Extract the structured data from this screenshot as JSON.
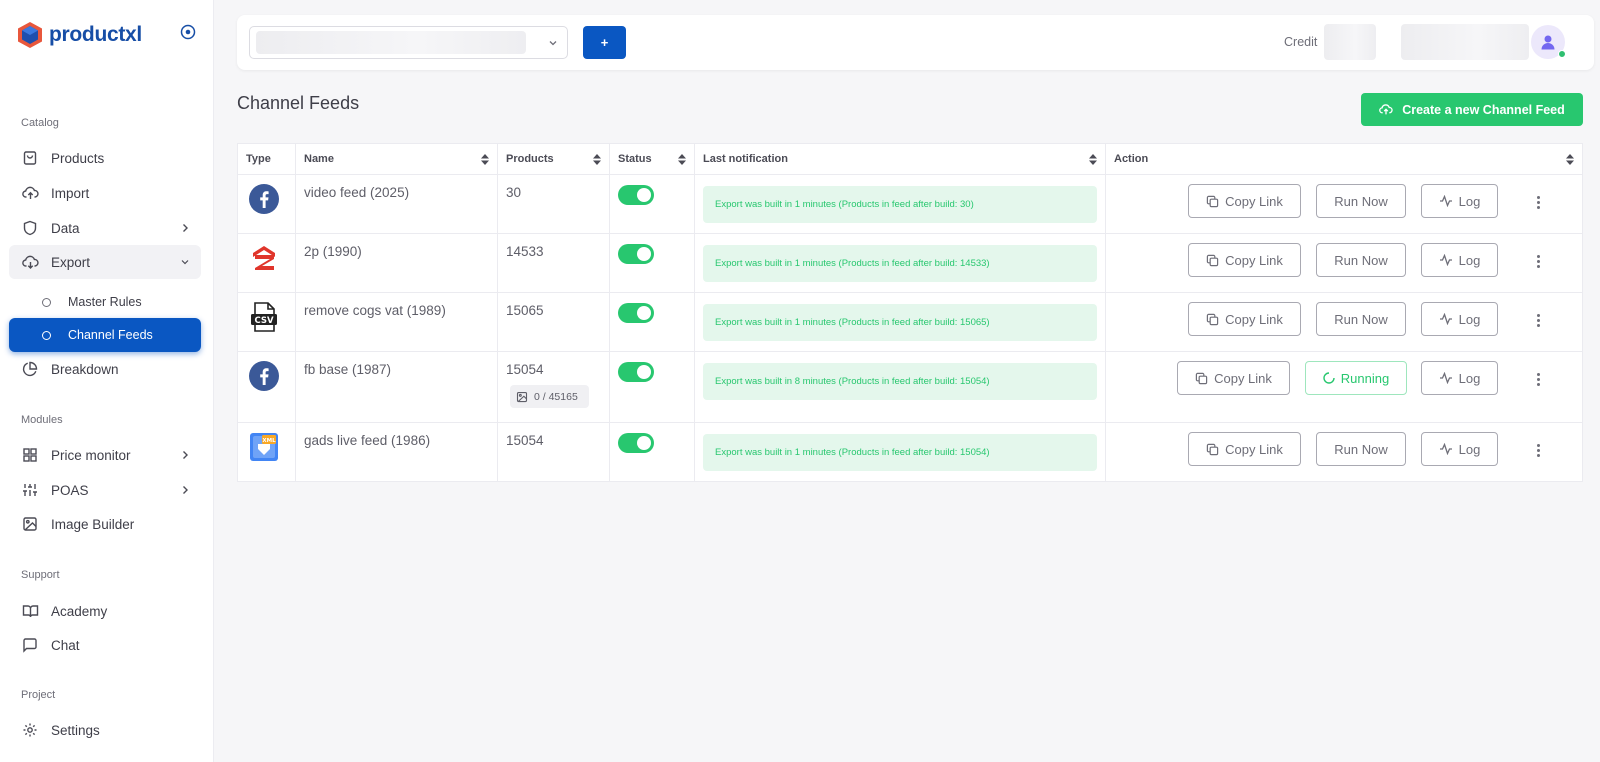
{
  "sidebar": {
    "logo_text": "productxl",
    "sections": {
      "catalog": "Catalog",
      "modules": "Modules",
      "support": "Support",
      "project": "Project"
    },
    "items": {
      "products": "Products",
      "import": "Import",
      "data": "Data",
      "export": "Export",
      "master_rules": "Master Rules",
      "channel_feeds": "Channel Feeds",
      "breakdown": "Breakdown",
      "price_monitor": "Price monitor",
      "poas": "POAS",
      "image_builder": "Image Builder",
      "academy": "Academy",
      "chat": "Chat",
      "settings": "Settings"
    }
  },
  "topbar": {
    "add_label": "+",
    "credit_label": "Credit"
  },
  "page": {
    "title": "Channel Feeds",
    "create_button": "Create a new Channel Feed"
  },
  "table": {
    "headers": {
      "type": "Type",
      "name": "Name",
      "products": "Products",
      "status": "Status",
      "last_notification": "Last notification",
      "action": "Action"
    },
    "actions": {
      "copy_link": "Copy Link",
      "run_now": "Run Now",
      "running": "Running",
      "log": "Log"
    },
    "rows": [
      {
        "type_icon": "facebook-icon",
        "name": "video feed (2025)",
        "products": "30",
        "notification": "Export was built in 1 minutes (Products in feed after build: 30)"
      },
      {
        "type_icon": "2p-logo-icon",
        "name": "2p (1990)",
        "products": "14533",
        "notification": "Export was built in 1 minutes (Products in feed after build: 14533)"
      },
      {
        "type_icon": "csv-file-icon",
        "name": "remove cogs vat (1989)",
        "products": "15065",
        "notification": "Export was built in 1 minutes (Products in feed after build: 15065)"
      },
      {
        "type_icon": "facebook-icon",
        "name": "fb base (1987)",
        "products": "15054",
        "image_count": "0 / 45165",
        "notification": "Export was built in 8 minutes (Products in feed after build: 15054)"
      },
      {
        "type_icon": "xml-feed-icon",
        "name": "gads live feed (1986)",
        "products": "15054",
        "notification": "Export was built in 1 minutes (Products in feed after build: 15054)"
      }
    ]
  },
  "colors": {
    "primary": "#0a57c2",
    "success": "#28c76f",
    "success_bg": "#e4f7ec",
    "facebook": "#3b5998",
    "logo_red": "#e0352b"
  }
}
